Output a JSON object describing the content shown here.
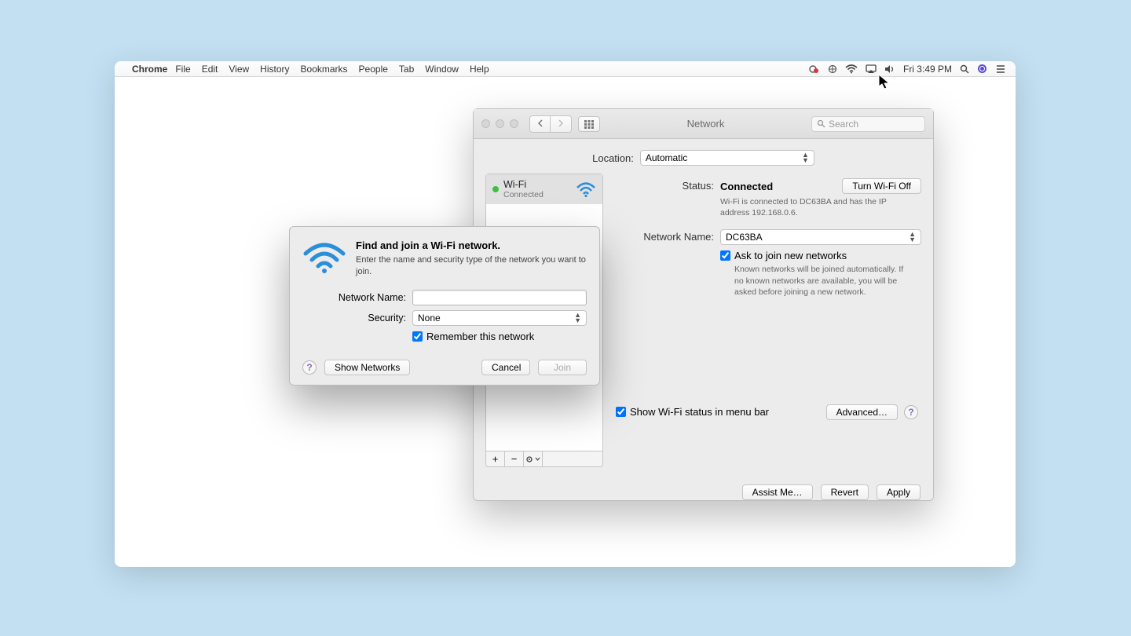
{
  "menubar": {
    "app": "Chrome",
    "items": [
      "File",
      "Edit",
      "View",
      "History",
      "Bookmarks",
      "People",
      "Tab",
      "Window",
      "Help"
    ],
    "clock": "Fri 3:49 PM"
  },
  "prefs": {
    "title": "Network",
    "search_placeholder": "Search",
    "location_label": "Location:",
    "location_value": "Automatic",
    "sidebar": {
      "wifi_name": "Wi-Fi",
      "wifi_status": "Connected"
    },
    "status_label": "Status:",
    "status_value": "Connected",
    "turn_off_btn": "Turn Wi-Fi Off",
    "status_help": "Wi-Fi is connected to DC63BA and has the IP address 192.168.0.6.",
    "netname_label": "Network Name:",
    "netname_value": "DC63BA",
    "ask_join_label": "Ask to join new networks",
    "ask_join_help": "Known networks will be joined automatically. If no known networks are available, you will be asked before joining a new network.",
    "show_menu_label": "Show Wi-Fi status in menu bar",
    "advanced_btn": "Advanced…",
    "assist_btn": "Assist Me…",
    "revert_btn": "Revert",
    "apply_btn": "Apply"
  },
  "dialog": {
    "title": "Find and join a Wi-Fi network.",
    "subtitle": "Enter the name and security type of the network you want to join.",
    "name_label": "Network Name:",
    "security_label": "Security:",
    "security_value": "None",
    "remember_label": "Remember this network",
    "show_networks_btn": "Show Networks",
    "cancel_btn": "Cancel",
    "join_btn": "Join"
  }
}
